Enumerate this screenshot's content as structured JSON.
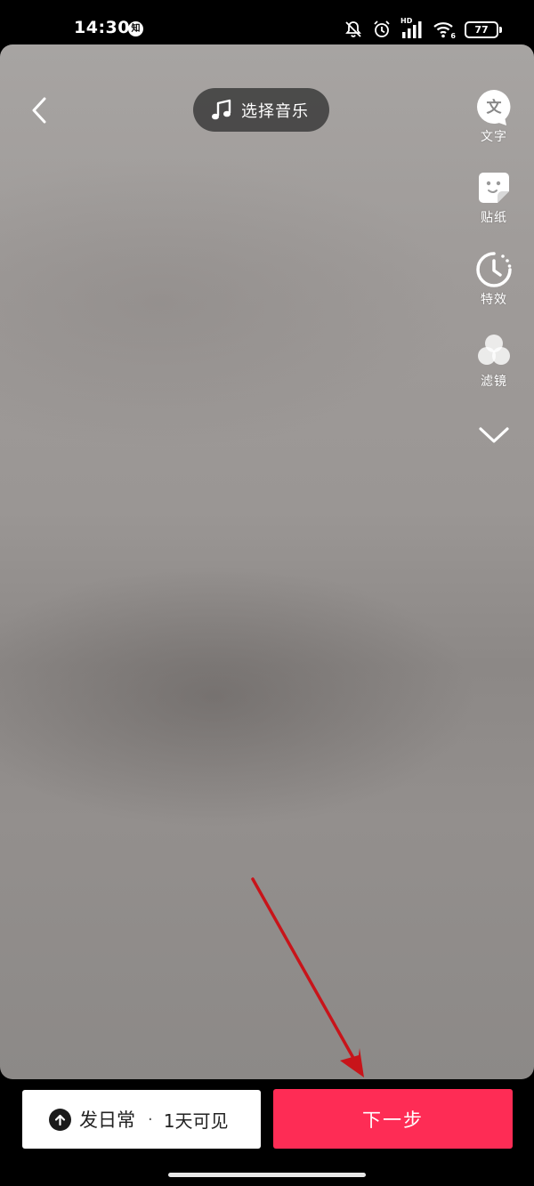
{
  "status_bar": {
    "time": "14:30",
    "notification_badge": "知",
    "network_label": "HD",
    "wifi_label": "6",
    "battery": "77"
  },
  "top_bar": {
    "music_label": "选择音乐"
  },
  "side_tools": [
    {
      "label": "文字",
      "icon_glyph": "文"
    },
    {
      "label": "贴纸"
    },
    {
      "label": "特效"
    },
    {
      "label": "滤镜"
    }
  ],
  "bottom_bar": {
    "daily_label": "发日常",
    "daily_separator": "·",
    "daily_visibility": "1天可见",
    "next_label": "下一步"
  },
  "colors": {
    "accent": "#fe2c55",
    "annotation_arrow": "#c8141a"
  }
}
